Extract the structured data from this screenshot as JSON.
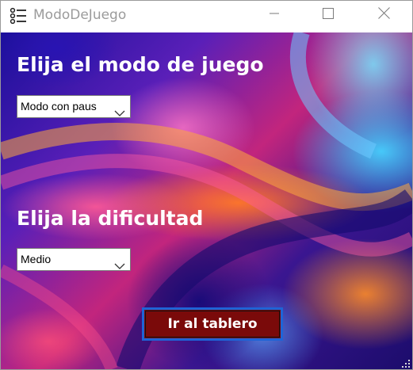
{
  "window": {
    "title": "ModoDeJuego",
    "app_icon": "list-icon",
    "controls": [
      "minimize-icon",
      "maximize-icon",
      "close-icon"
    ]
  },
  "mode": {
    "heading": "Elija el modo de juego",
    "selected": "Modo con paus"
  },
  "difficulty": {
    "heading": "Elija la dificultad",
    "selected": "Medio"
  },
  "actions": {
    "go_label": "Ir al tablero"
  },
  "colors": {
    "button_fill": "#7a0a0a",
    "button_border": "#1e64d6",
    "title_text": "#9b9b9b"
  }
}
